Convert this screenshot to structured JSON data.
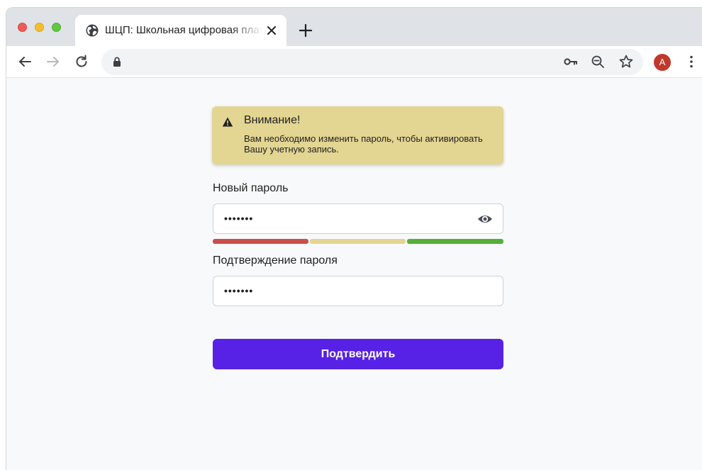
{
  "browser": {
    "tab": {
      "title": "ШЦП: Школьная цифровая платформа",
      "favicon": "globe-icon"
    },
    "avatar_letter": "A",
    "colors": {
      "avatar": "#c0392b",
      "tab_strip": "#dfe2e7"
    }
  },
  "alert": {
    "title": "Внимание!",
    "message": "Вам необходимо изменить пароль, чтобы активировать Вашу учетную запись.",
    "icon": "warning-icon",
    "color": "#e3d592"
  },
  "form": {
    "new_password": {
      "label": "Новый пароль",
      "value": "•••••••",
      "icon": "eye-icon"
    },
    "strength": {
      "colors": [
        "#c9504a",
        "#e3d592",
        "#55b038"
      ],
      "level": 3,
      "max": 3
    },
    "confirm_password": {
      "label": "Подтверждение пароля",
      "value": "•••••••"
    },
    "submit": {
      "label": "Подтвердить",
      "color": "#5721e6"
    }
  }
}
